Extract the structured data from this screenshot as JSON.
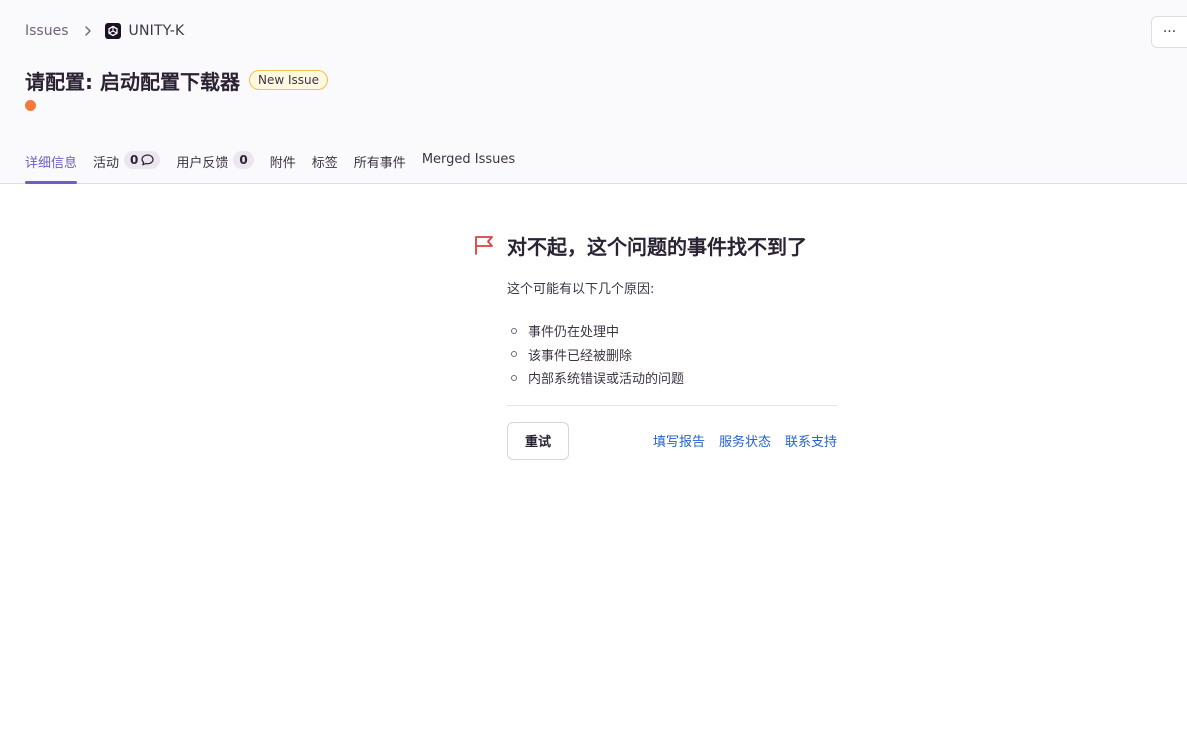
{
  "breadcrumb": {
    "root": "Issues",
    "project": "UNITY-K"
  },
  "header": {
    "more_label": "···",
    "title": "请配置: 启动配置下载器",
    "badge": "New Issue"
  },
  "colors": {
    "accent": "#6c5fc7",
    "level_dot": "#f5793a",
    "flag": "#e03e3e",
    "link": "#2562d4",
    "badge_border": "#f2c14e"
  },
  "tabs": [
    {
      "label": "详细信息",
      "active": true
    },
    {
      "label": "活动",
      "count": "0",
      "icon": "comment-icon"
    },
    {
      "label": "用户反馈",
      "count": "0"
    },
    {
      "label": "附件"
    },
    {
      "label": "标签"
    },
    {
      "label": "所有事件"
    },
    {
      "label": "Merged Issues"
    }
  ],
  "empty_state": {
    "icon": "flag-icon",
    "heading": "对不起，这个问题的事件找不到了",
    "description": "这个可能有以下几个原因:",
    "reasons": [
      "事件仍在处理中",
      "该事件已经被删除",
      "内部系统错误或活动的问题"
    ],
    "retry_label": "重试",
    "links": [
      "填写报告",
      "服务状态",
      "联系支持"
    ]
  }
}
